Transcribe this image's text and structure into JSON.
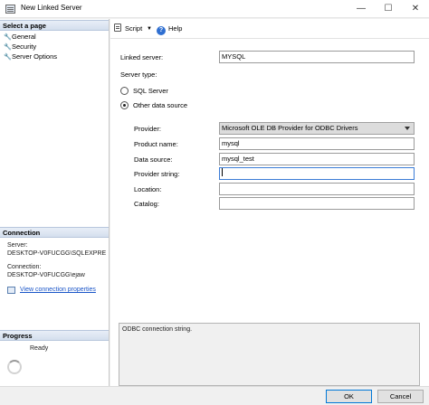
{
  "window": {
    "title": "New Linked Server",
    "minimize_glyph": "—",
    "maximize_glyph": "☐",
    "close_glyph": "✕"
  },
  "sidebar": {
    "select_page_header": "Select a page",
    "pages": [
      {
        "label": "General",
        "icon": "wrench-icon"
      },
      {
        "label": "Security",
        "icon": "wrench-icon"
      },
      {
        "label": "Server Options",
        "icon": "wrench-icon"
      }
    ],
    "connection_header": "Connection",
    "server_label": "Server:",
    "server_value": "DESKTOP-V0FUCGG\\SQLEXPRE",
    "connection_label": "Connection:",
    "connection_value": "DESKTOP-V0FUCGG\\ejaw",
    "view_properties_link": "View connection properties",
    "progress_header": "Progress",
    "progress_status": "Ready"
  },
  "toolbar": {
    "script_label": "Script",
    "help_label": "Help"
  },
  "form": {
    "linked_server_label": "Linked server:",
    "linked_server_value": "MYSQL",
    "server_type_label": "Server type:",
    "sql_server_option": "SQL Server",
    "other_source_option": "Other data source",
    "selected_server_type": "Other data source",
    "provider_label": "Provider:",
    "provider_value": "Microsoft OLE DB Provider for ODBC Drivers",
    "product_name_label": "Product name:",
    "product_name_value": "mysql",
    "data_source_label": "Data source:",
    "data_source_value": "mysql_test",
    "provider_string_label": "Provider string:",
    "provider_string_value": "",
    "location_label": "Location:",
    "location_value": "",
    "catalog_label": "Catalog:",
    "catalog_value": "",
    "description": "ODBC connection string."
  },
  "footer": {
    "ok_label": "OK",
    "cancel_label": "Cancel"
  },
  "colors": {
    "link": "#1a55c8",
    "section_header": "#d4dfee",
    "focus_border": "#3b7cd6"
  }
}
